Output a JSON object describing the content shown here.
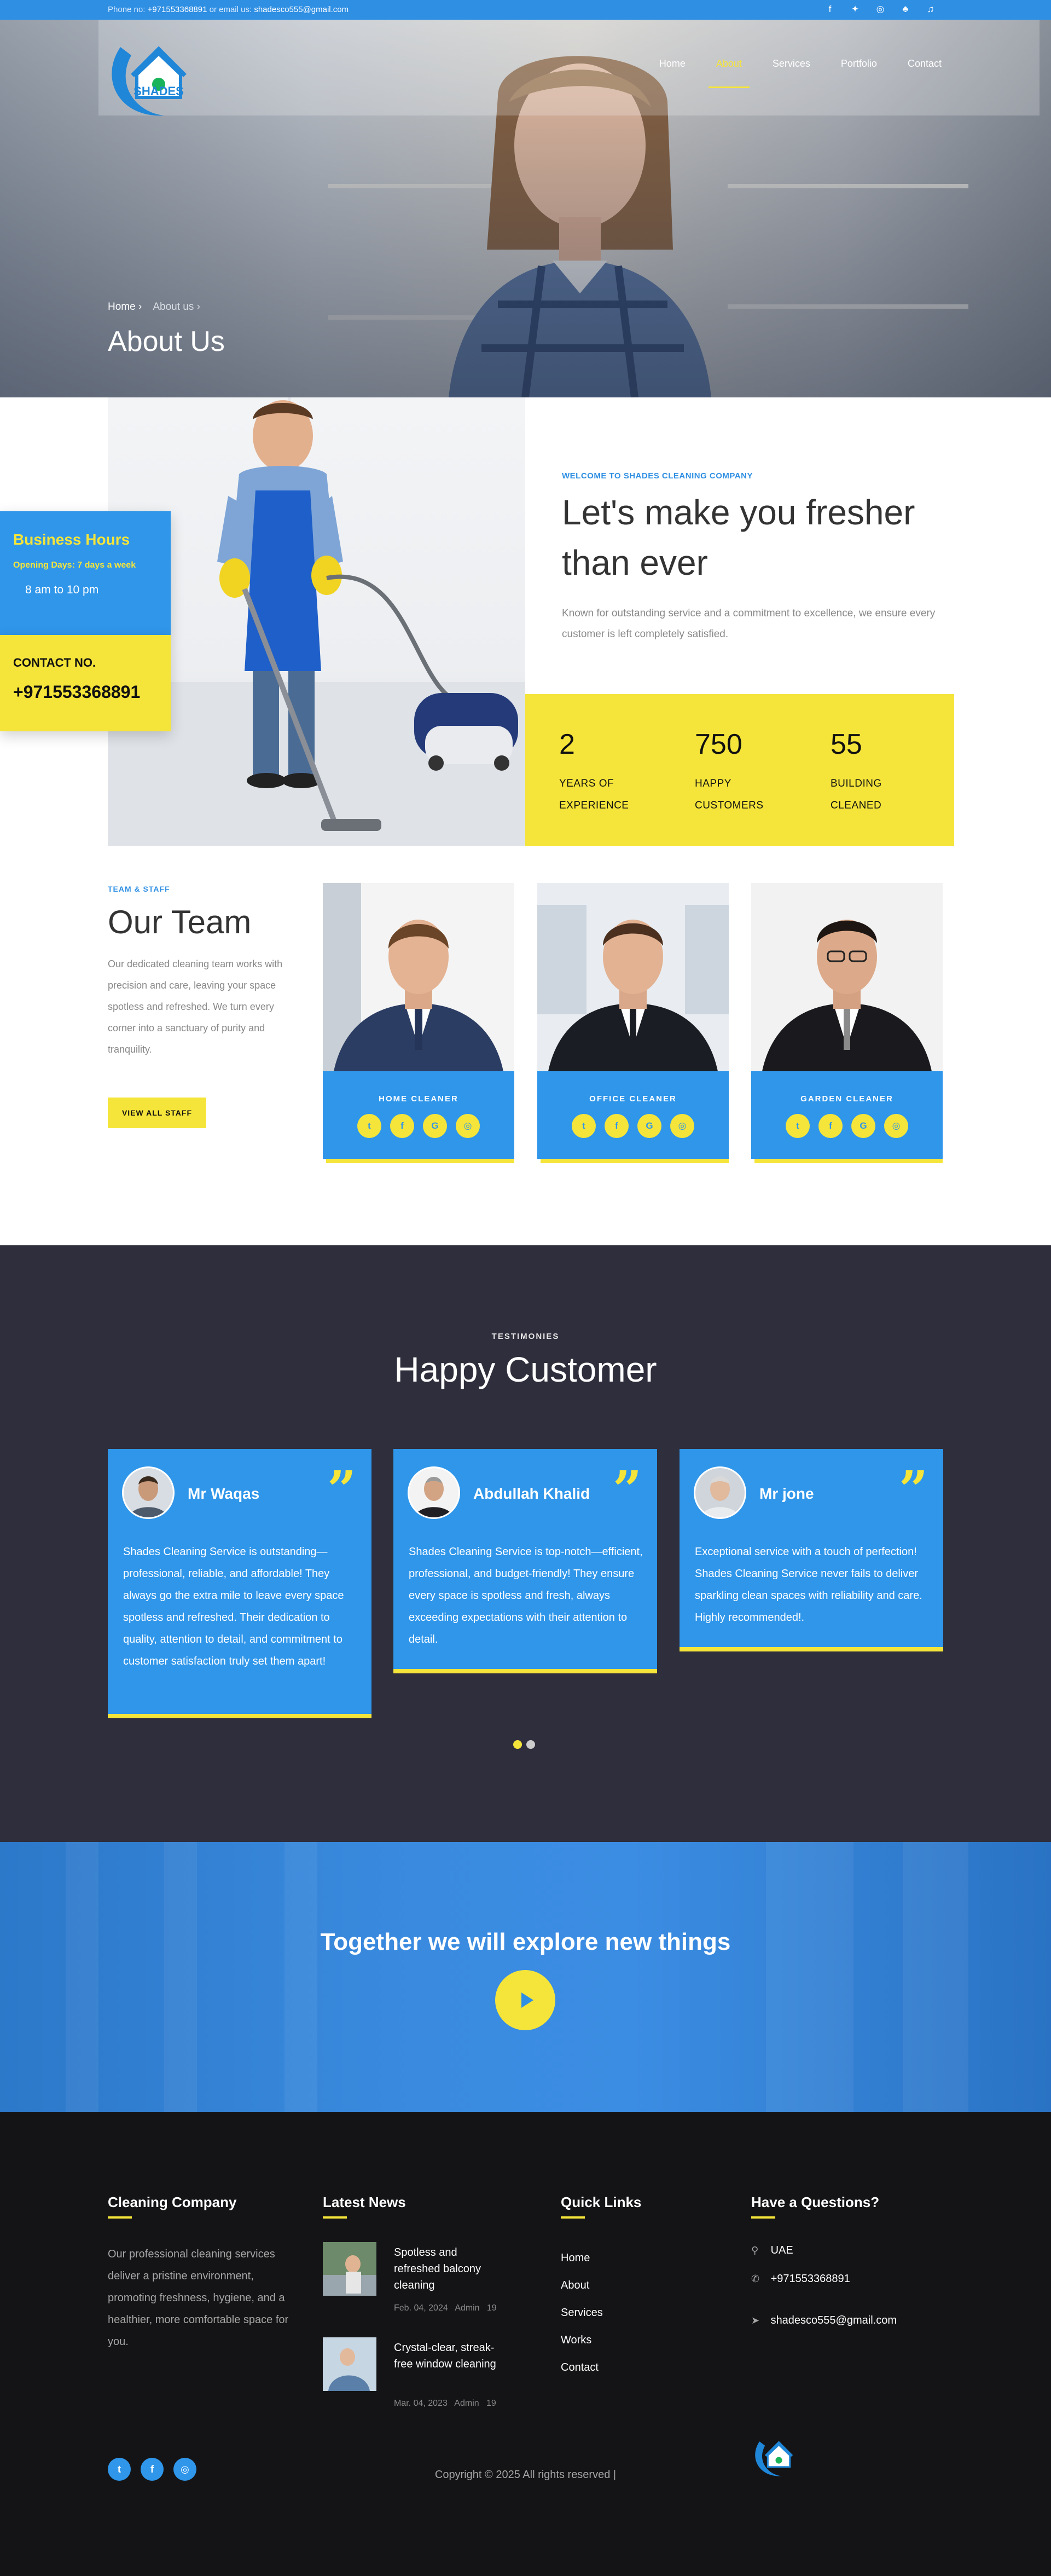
{
  "topbar": {
    "phone_label": "Phone no:",
    "phone": "+971553368891",
    "email_label": "or email us:",
    "email": "shadesco555@gmail.com"
  },
  "nav": {
    "items": [
      {
        "label": "Home"
      },
      {
        "label": "About"
      },
      {
        "label": "Services"
      },
      {
        "label": "Portfolio"
      },
      {
        "label": "Contact"
      }
    ],
    "active": "About"
  },
  "logo": {
    "text": "SHADES"
  },
  "hero": {
    "breadcrumb": [
      "Home",
      "About us"
    ],
    "title": "About Us"
  },
  "business_hours": {
    "title": "Business Hours",
    "days": "Opening Days: 7 days a week",
    "time": "8 am to 10 pm"
  },
  "contact_card": {
    "label": "CONTACT NO.",
    "number": "+971553368891"
  },
  "about": {
    "tag": "WELCOME TO SHADES CLEANING COMPANY",
    "headline": "Let's make you fresher than ever",
    "text": "Known for outstanding service and a commitment to excellence, we ensure every customer is left completely satisfied.",
    "stats": [
      {
        "number": "2",
        "label": "YEARS OF EXPERIENCE"
      },
      {
        "number": "750",
        "label": "HAPPY CUSTOMERS"
      },
      {
        "number": "55",
        "label": "BUILDING CLEANED"
      }
    ]
  },
  "team": {
    "tag": "TEAM & STAFF",
    "title": "Our Team",
    "text": "Our dedicated cleaning team works with precision and care, leaving your space spotless and refreshed. We turn every corner into a sanctuary of purity and tranquility.",
    "button": "VIEW ALL STAFF",
    "members": [
      {
        "role": "HOME CLEANER",
        "suit": "#2b3d63",
        "tie": "#243559"
      },
      {
        "role": "OFFICE CLEANER",
        "suit": "#1b1d24",
        "tie": "#1b1d24"
      },
      {
        "role": "GARDEN CLEANER",
        "suit": "#1a1a1e",
        "tie": "#8a8a8a"
      }
    ],
    "socials": [
      "twitter-icon",
      "facebook-icon",
      "google-icon",
      "instagram-icon"
    ]
  },
  "testimonials": {
    "tag": "TESTIMONIES",
    "title": "Happy Customer",
    "items": [
      {
        "name": "Mr Waqas",
        "text": "Shades Cleaning Service is outstanding—professional, reliable, and affordable! They always go the extra mile to leave every space spotless and refreshed. Their dedication to quality, attention to detail, and commitment to customer satisfaction truly set them apart!"
      },
      {
        "name": "Abdullah Khalid",
        "text": "Shades Cleaning Service is top-notch—efficient, professional, and budget-friendly! They ensure every space is spotless and fresh, always exceeding expectations with their attention to detail."
      },
      {
        "name": "Mr jone",
        "text": "Exceptional service with a touch of perfection! Shades Cleaning Service never fails to deliver sparkling clean spaces with reliability and care. Highly recommended!."
      }
    ]
  },
  "banner": {
    "title": "Together we will explore new things"
  },
  "footer": {
    "about_title": "Cleaning Company",
    "about_text": "Our professional cleaning services deliver a pristine environment, promoting freshness, hygiene, and a healthier, more comfortable space for you.",
    "news_title": "Latest News",
    "news": [
      {
        "title": "Spotless and refreshed balcony cleaning",
        "date": "Feb. 04, 2024",
        "author": "Admin",
        "comments": "19"
      },
      {
        "title": "Crystal-clear, streak-free window cleaning",
        "date": "Mar. 04, 2023",
        "author": "Admin",
        "comments": "19"
      }
    ],
    "links_title": "Quick Links",
    "links": [
      "Home",
      "About",
      "Services",
      "Works",
      "Contact"
    ],
    "questions_title": "Have a Questions?",
    "location": "UAE",
    "phone": "+971553368891",
    "email": "shadesco555@gmail.com",
    "copyright": "Copyright © 2025 All rights reserved |"
  },
  "colors": {
    "blue": "#2f8fe3",
    "yellow": "#f5e53a",
    "dark": "#2f2e3c",
    "footer": "#141416"
  }
}
